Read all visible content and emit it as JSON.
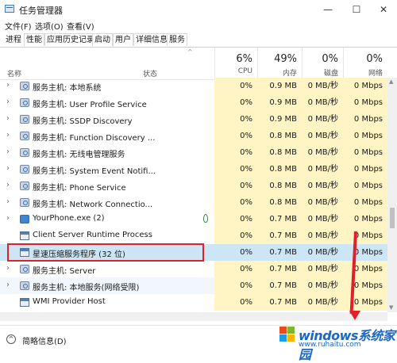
{
  "window": {
    "title": "任务管理器",
    "min": "—",
    "max": "☐",
    "close": "✕"
  },
  "menu": [
    "文件(F)",
    "选项(O)",
    "查看(V)"
  ],
  "tabs": [
    "进程",
    "性能",
    "应用历史记录",
    "启动",
    "用户",
    "详细信息",
    "服务"
  ],
  "header": {
    "name": "名称",
    "status": "状态",
    "cpu": {
      "pct": "6%",
      "label": "CPU"
    },
    "memory": {
      "pct": "49%",
      "label": "内存"
    },
    "disk": {
      "pct": "0%",
      "label": "磁盘"
    },
    "network": {
      "pct": "0%",
      "label": "网络"
    }
  },
  "processes": [
    {
      "name": "服务主机: 本地系统",
      "cpu": "0%",
      "mem": "0.9 MB",
      "disk": "0 MB/秒",
      "net": "0 Mbps",
      "expand": true,
      "icon": "gear-icon"
    },
    {
      "name": "服务主机: User Profile Service",
      "cpu": "0%",
      "mem": "0.9 MB",
      "disk": "0 MB/秒",
      "net": "0 Mbps",
      "expand": true,
      "icon": "gear-icon"
    },
    {
      "name": "服务主机: SSDP Discovery",
      "cpu": "0%",
      "mem": "0.9 MB",
      "disk": "0 MB/秒",
      "net": "0 Mbps",
      "expand": true,
      "icon": "gear-icon"
    },
    {
      "name": "服务主机: Function Discovery ...",
      "cpu": "0%",
      "mem": "0.8 MB",
      "disk": "0 MB/秒",
      "net": "0 Mbps",
      "expand": true,
      "icon": "gear-icon"
    },
    {
      "name": "服务主机: 无线电管理服务",
      "cpu": "0%",
      "mem": "0.8 MB",
      "disk": "0 MB/秒",
      "net": "0 Mbps",
      "expand": true,
      "icon": "gear-icon"
    },
    {
      "name": "服务主机: System Event Notifi...",
      "cpu": "0%",
      "mem": "0.8 MB",
      "disk": "0 MB/秒",
      "net": "0 Mbps",
      "expand": true,
      "icon": "gear-icon"
    },
    {
      "name": "服务主机: Phone Service",
      "cpu": "0%",
      "mem": "0.8 MB",
      "disk": "0 MB/秒",
      "net": "0 Mbps",
      "expand": true,
      "icon": "gear-icon"
    },
    {
      "name": "服务主机: Network Connectio...",
      "cpu": "0%",
      "mem": "0.8 MB",
      "disk": "0 MB/秒",
      "net": "0 Mbps",
      "expand": true,
      "icon": "gear-icon"
    },
    {
      "name": "YourPhone.exe (2)",
      "cpu": "0%",
      "mem": "0.7 MB",
      "disk": "0 MB/秒",
      "net": "0 Mbps",
      "expand": true,
      "icon": "phone-icon",
      "suspended": true
    },
    {
      "name": "Client Server Runtime Process",
      "cpu": "0%",
      "mem": "0.7 MB",
      "disk": "0 MB/秒",
      "net": "0 Mbps",
      "expand": false,
      "icon": "app-window-icon"
    },
    {
      "name": "星速压缩服务程序 (32 位)",
      "cpu": "0%",
      "mem": "0.7 MB",
      "disk": "0 MB/秒",
      "net": "0 Mbps",
      "expand": false,
      "icon": "app-window-icon",
      "selected": true
    },
    {
      "name": "服务主机: Server",
      "cpu": "0%",
      "mem": "0.7 MB",
      "disk": "0 MB/秒",
      "net": "0 Mbps",
      "expand": true,
      "icon": "gear-icon"
    },
    {
      "name": "服务主机: 本地服务(网络受限)",
      "cpu": "0%",
      "mem": "0.7 MB",
      "disk": "0 MB/秒",
      "net": "0 Mbps",
      "expand": true,
      "icon": "gear-icon",
      "hover": true
    },
    {
      "name": "WMI Provider Host",
      "cpu": "0%",
      "mem": "0.7 MB",
      "disk": "0 MB/秒",
      "net": "0 Mbps",
      "expand": false,
      "icon": "app-window-icon"
    }
  ],
  "footer": {
    "fewer_details": "简略信息(D)"
  },
  "watermark": {
    "text": "windows系统家园",
    "sub": "www.ruhaitu.com"
  }
}
